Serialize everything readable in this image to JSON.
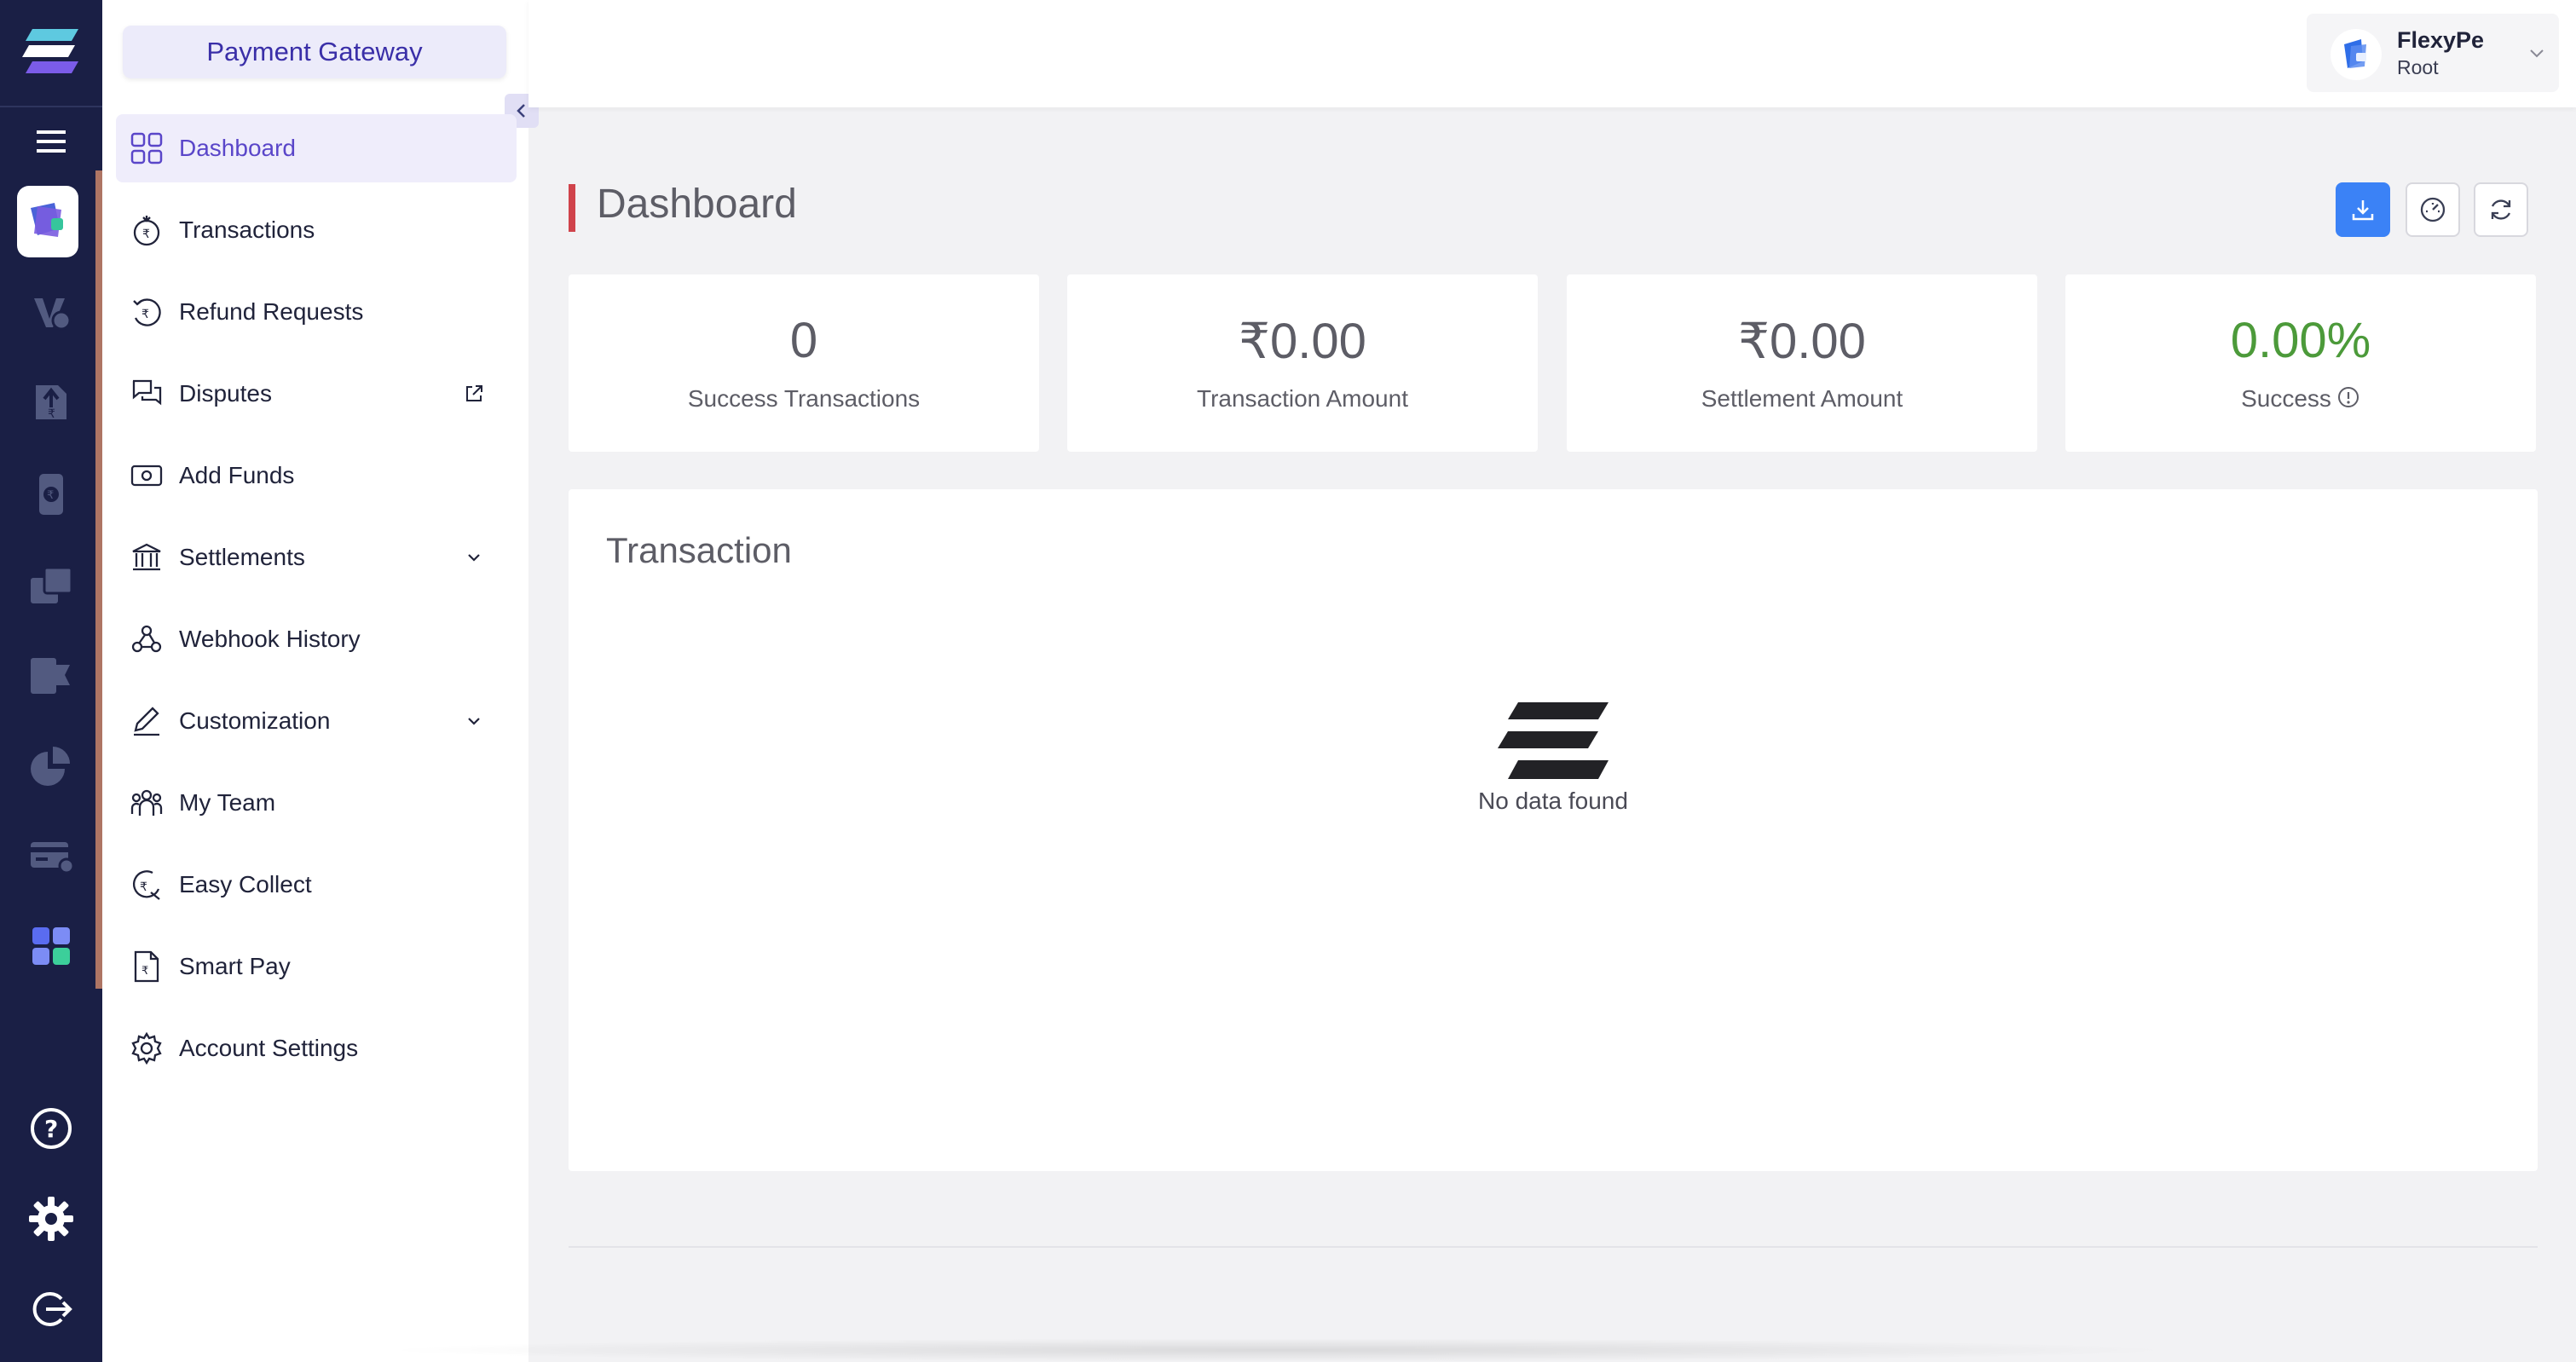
{
  "sidebar": {
    "product_label": "Payment Gateway",
    "items": [
      {
        "label": "Dashboard",
        "icon": "grid-icon",
        "active": true
      },
      {
        "label": "Transactions",
        "icon": "rupee-timer-icon"
      },
      {
        "label": "Refund Requests",
        "icon": "rupee-refund-icon"
      },
      {
        "label": "Disputes",
        "icon": "chat-bubbles-icon",
        "suffix_icon": "external-link-icon"
      },
      {
        "label": "Add Funds",
        "icon": "banknote-icon"
      },
      {
        "label": "Settlements",
        "icon": "bank-icon",
        "suffix_icon": "chevron-down-icon"
      },
      {
        "label": "Webhook History",
        "icon": "webhook-icon"
      },
      {
        "label": "Customization",
        "icon": "pen-icon",
        "suffix_icon": "chevron-down-icon"
      },
      {
        "label": "My Team",
        "icon": "team-icon"
      },
      {
        "label": "Easy Collect",
        "icon": "rupee-collect-icon"
      },
      {
        "label": "Smart Pay",
        "icon": "rupee-document-icon"
      },
      {
        "label": "Account Settings",
        "icon": "gear-icon"
      }
    ]
  },
  "account": {
    "name": "FlexyPe",
    "role": "Root"
  },
  "page": {
    "title": "Dashboard"
  },
  "stats": [
    {
      "value": "0",
      "label": "Success Transactions"
    },
    {
      "value": "₹0.00",
      "label": "Transaction Amount"
    },
    {
      "value": "₹0.00",
      "label": "Settlement Amount"
    },
    {
      "value": "0.00%",
      "label": "Success",
      "color": "#4c9a3a"
    }
  ],
  "panel": {
    "title": "Transaction",
    "empty_text": "No data found"
  },
  "colors": {
    "rail": "#1a1f45",
    "accent": "#5a46c9",
    "primary_button": "#3b82f6",
    "title_bar": "#d0434b",
    "success": "#4c9a3a"
  }
}
